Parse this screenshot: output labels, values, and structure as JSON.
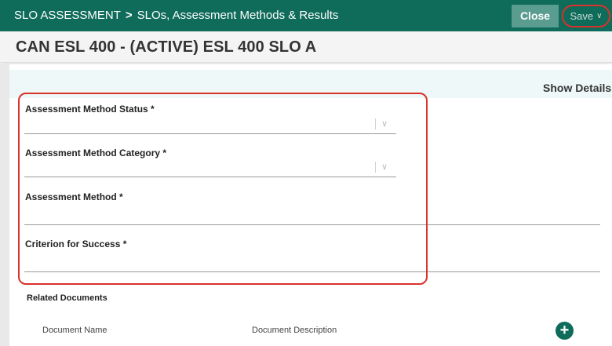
{
  "header": {
    "breadcrumb_root": "SLO ASSESSMENT",
    "breadcrumb_sep": ">",
    "breadcrumb_current": "SLOs, Assessment Methods & Results",
    "close_label": "Close",
    "save_label": "Save",
    "save_icon": "chevron-down-icon"
  },
  "page": {
    "title": "CAN ESL 400 - (ACTIVE) ESL 400 SLO A",
    "show_details_label": "Show Details",
    "show_details_icon": "download-arrow-icon"
  },
  "form": {
    "status_label": "Assessment Method Status *",
    "category_label": "Assessment Method Category *",
    "method_label": "Assessment Method *",
    "criterion_label": "Criterion for Success *"
  },
  "related": {
    "heading": "Related Documents",
    "col_name": "Document Name",
    "col_description": "Document Description",
    "add_icon": "plus-circle-icon"
  },
  "colors": {
    "brand": "#0f6b5a",
    "highlight": "#d9322a"
  }
}
